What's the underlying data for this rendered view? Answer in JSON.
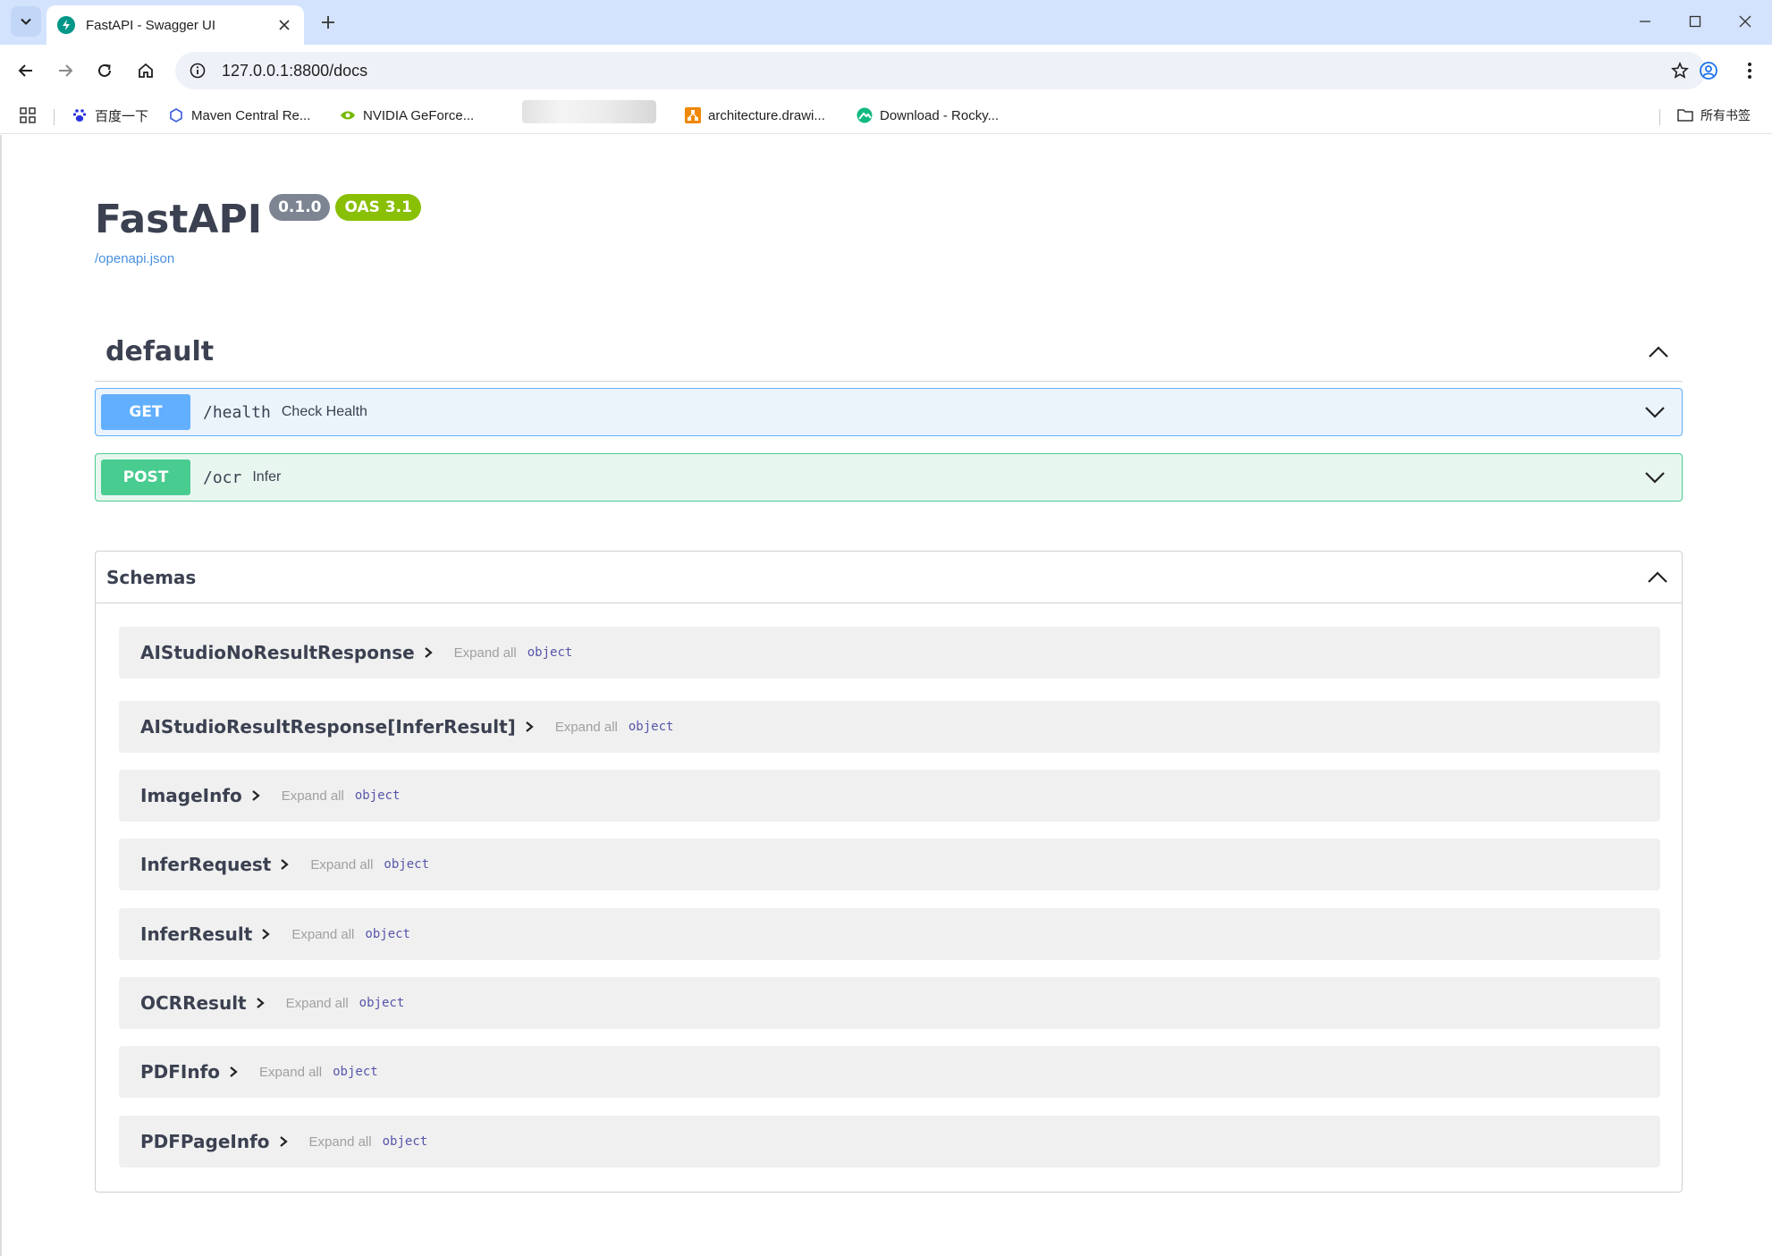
{
  "browser": {
    "tab_title": "FastAPI - Swagger UI",
    "url": "127.0.0.1:8800/docs",
    "bookmarks": [
      {
        "label": "百度一下",
        "icon": "baidu-paw-icon"
      },
      {
        "label": "Maven Central Re...",
        "icon": "hexagon-icon"
      },
      {
        "label": "NVIDIA GeForce...",
        "icon": "nvidia-eye-icon"
      },
      {
        "label": "architecture.drawi...",
        "icon": "drawio-icon"
      },
      {
        "label": "Download - Rocky...",
        "icon": "rocky-icon"
      }
    ],
    "all_bookmarks_label": "所有书签"
  },
  "api": {
    "title": "FastAPI",
    "version": "0.1.0",
    "oas_version": "OAS 3.1",
    "spec_link": "/openapi.json"
  },
  "tag": {
    "name": "default",
    "operations": [
      {
        "method": "GET",
        "path": "/health",
        "summary": "Check Health",
        "color": "#61affe"
      },
      {
        "method": "POST",
        "path": "/ocr",
        "summary": "Infer",
        "color": "#49cc90"
      }
    ]
  },
  "schemas": {
    "title": "Schemas",
    "expand_all_label": "Expand all",
    "items": [
      {
        "name": "AIStudioNoResultResponse",
        "type": "object"
      },
      {
        "name": "AIStudioResultResponse[InferResult]",
        "type": "object"
      },
      {
        "name": "ImageInfo",
        "type": "object"
      },
      {
        "name": "InferRequest",
        "type": "object"
      },
      {
        "name": "InferResult",
        "type": "object"
      },
      {
        "name": "OCRResult",
        "type": "object"
      },
      {
        "name": "PDFInfo",
        "type": "object"
      },
      {
        "name": "PDFPageInfo",
        "type": "object"
      }
    ]
  },
  "colors": {
    "tabbar": "#d3e3fd",
    "get": "#61affe",
    "post": "#49cc90",
    "version_badge": "#7d8492",
    "oas_badge": "#89bf04",
    "link": "#4990e2"
  }
}
